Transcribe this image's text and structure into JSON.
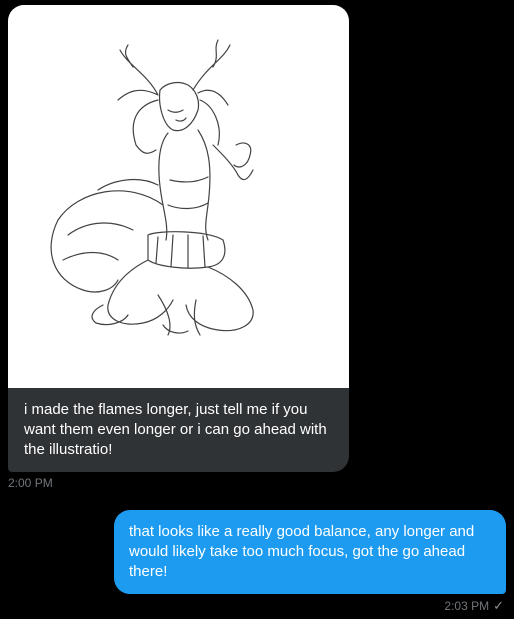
{
  "conversation": {
    "incoming": {
      "image_alt": "sketch of a character with antlers and a large fluffy tail",
      "text": "i made the flames longer, just tell me if you want them even longer or i can go ahead with the illustratio!",
      "time": "2:00 PM"
    },
    "outgoing": {
      "text": "that looks like a really good balance, any longer and would likely take too much focus, got the go ahead there!",
      "time": "2:03 PM",
      "status_icon": "check-icon"
    }
  },
  "colors": {
    "background": "#000000",
    "incoming_bubble": "#2f3336",
    "outgoing_bubble": "#1d9bf0",
    "timestamp": "#71767b"
  }
}
